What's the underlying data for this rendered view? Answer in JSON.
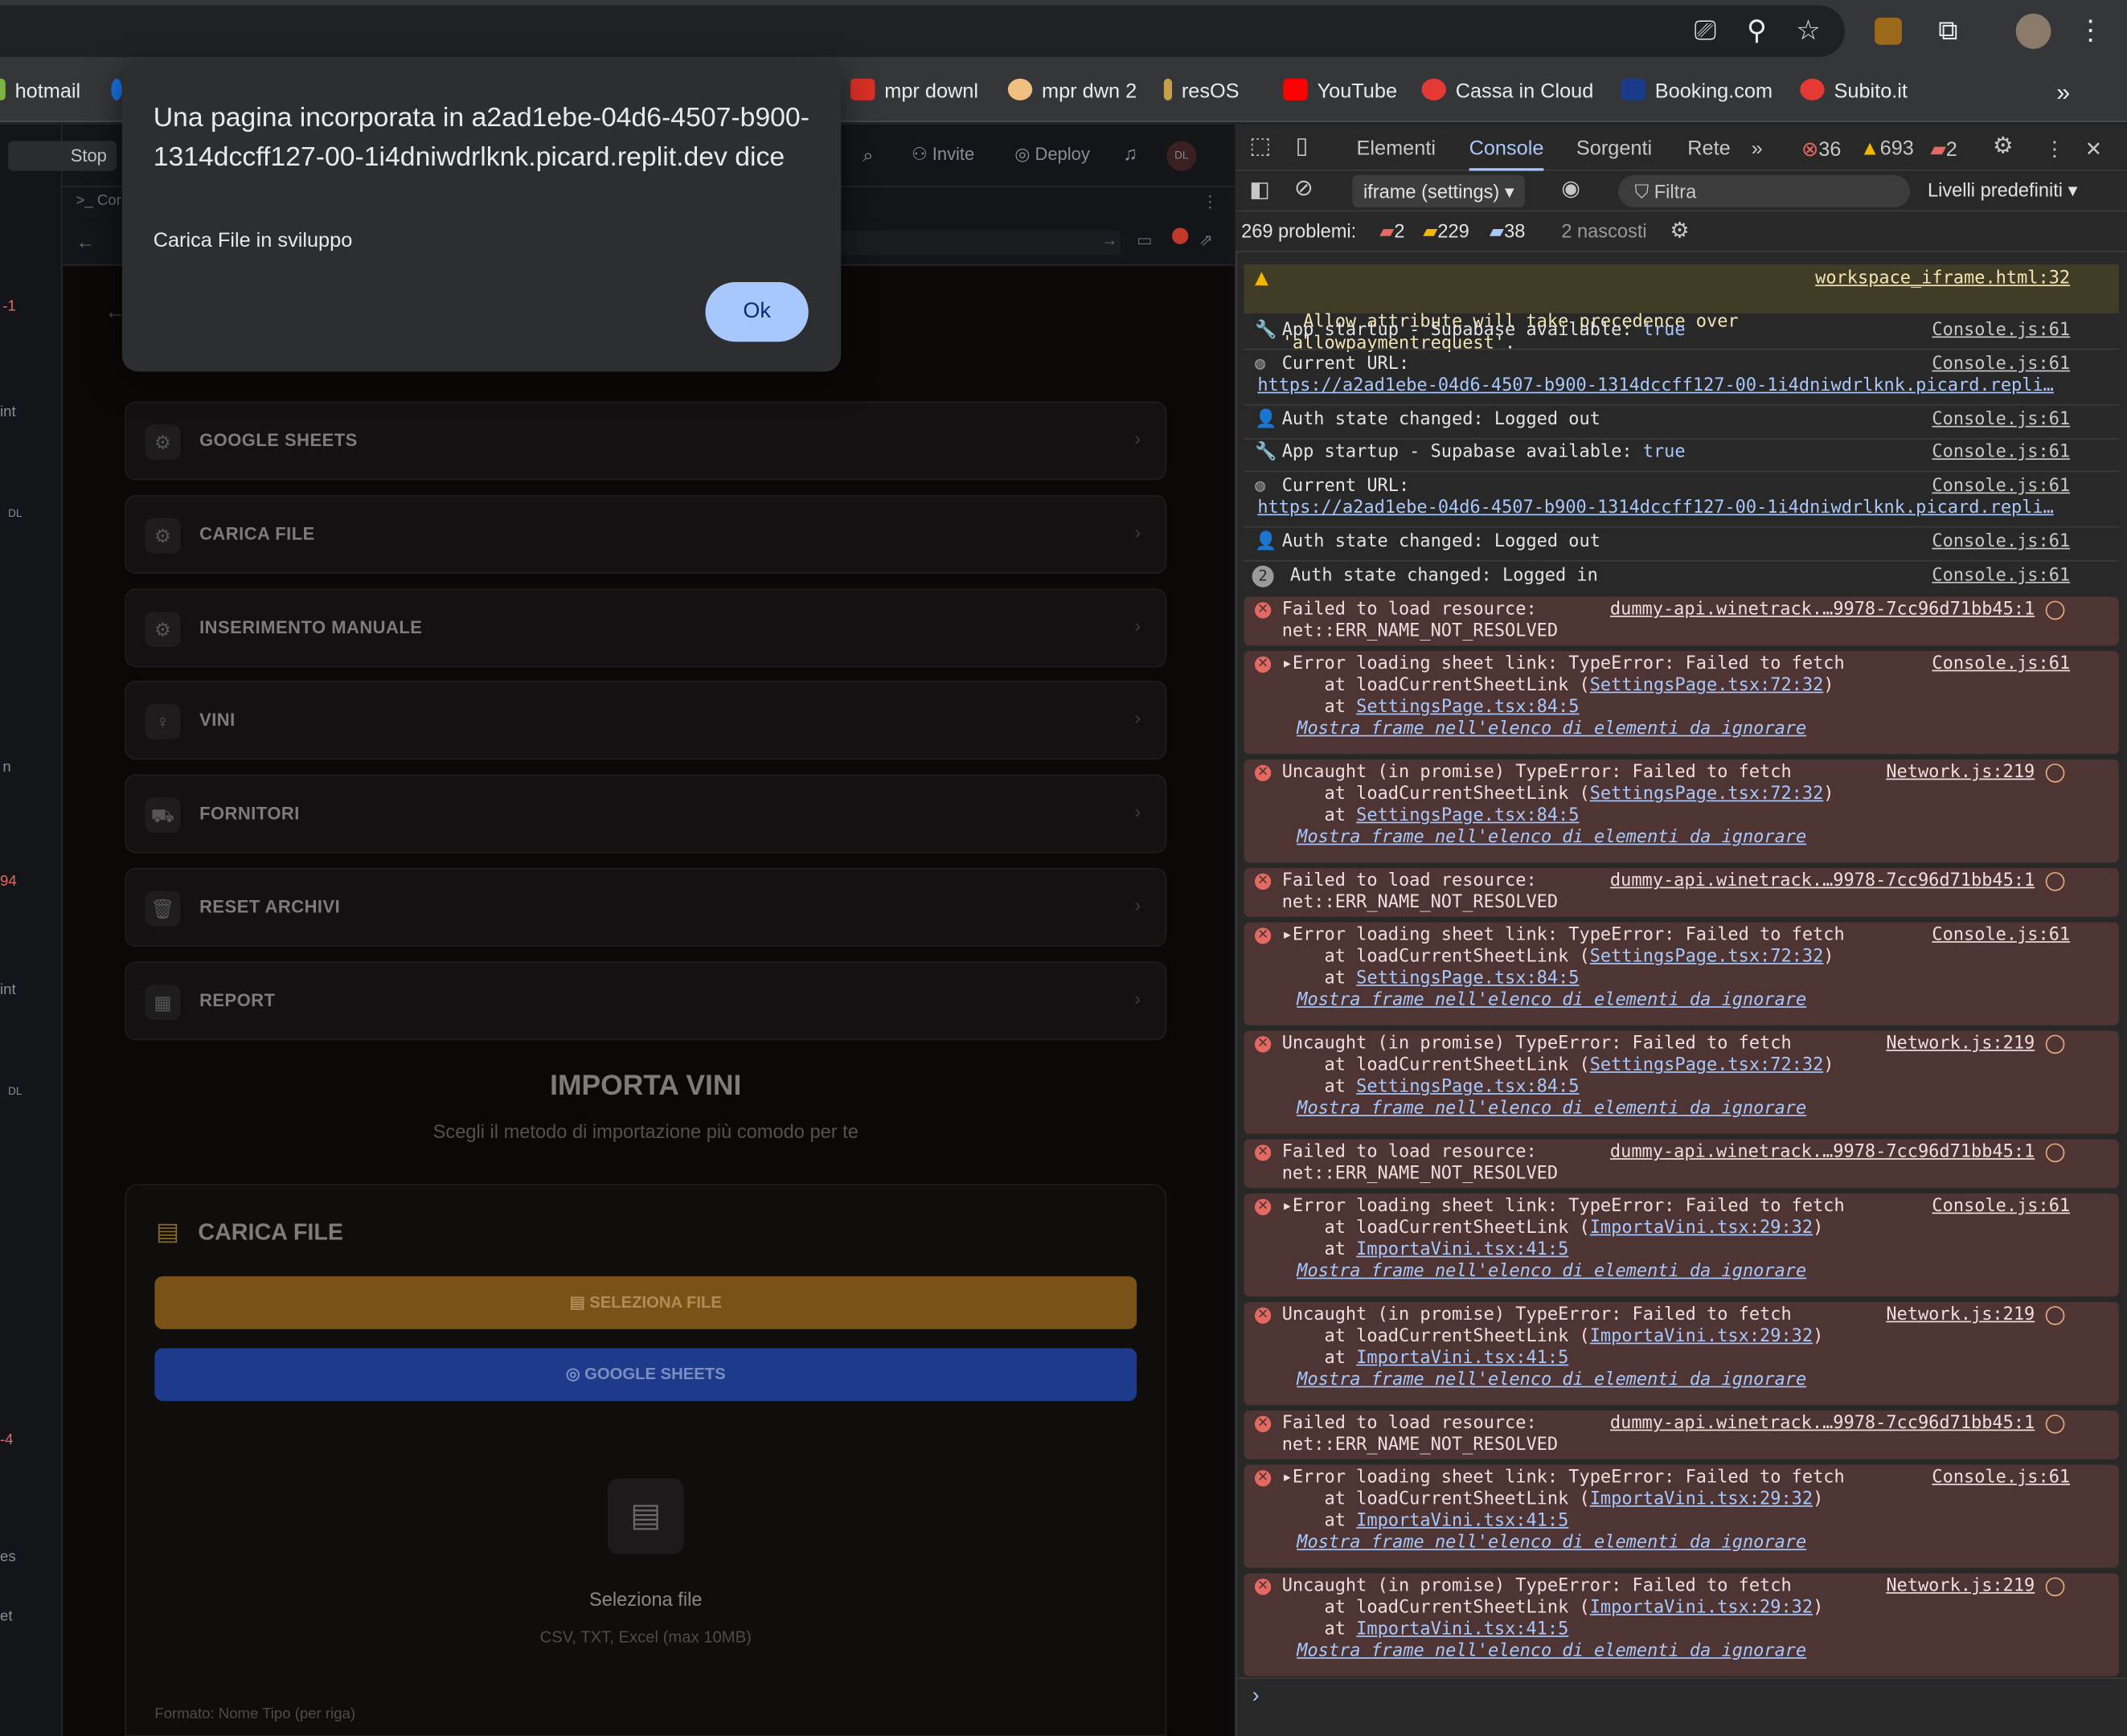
{
  "browser": {
    "bookmarks": [
      "hotmail",
      "mpr downl",
      "mpr dwn 2",
      "resOS",
      "YouTube",
      "Cassa in Cloud",
      "Booking.com",
      "Subito.it"
    ]
  },
  "replit": {
    "stop": "Stop",
    "invite": "Invite",
    "deploy": "Deploy",
    "avatar": "DL",
    "tab_partial": "Cor",
    "strip_items": [
      "-1",
      "int",
      "DL",
      "n",
      "94",
      "int",
      "DL",
      "-4",
      "es",
      "et"
    ]
  },
  "app": {
    "menu": [
      {
        "label": "GOOGLE SHEETS",
        "icon": "gear-icon"
      },
      {
        "label": "CARICA FILE",
        "icon": "gear-icon"
      },
      {
        "label": "INSERIMENTO MANUALE",
        "icon": "gear-icon"
      },
      {
        "label": "VINI",
        "icon": "wine-icon"
      },
      {
        "label": "FORNITORI",
        "icon": "truck-icon"
      },
      {
        "label": "RESET ARCHIVI",
        "icon": "trash-icon"
      },
      {
        "label": "REPORT",
        "icon": "calendar-icon"
      }
    ],
    "import_title": "IMPORTA VINI",
    "import_subtitle": "Scegli il metodo di importazione più comodo per te",
    "panel_title": "CARICA FILE",
    "select_file_button": "SELEZIONA FILE",
    "google_sheets_button": "GOOGLE SHEETS",
    "drop_title": "Seleziona file",
    "drop_hint": "CSV, TXT, Excel (max 10MB)",
    "format": "Formato: Nome Tipo (per riga)",
    "colors": {
      "select": "#8a5c1c",
      "sheets": "#1e3a8a"
    }
  },
  "dialog": {
    "title": "Una pagina incorporata in a2ad1ebe-04d6-4507-b900-1314dccff127-00-1i4dniwdrlknk.picard.replit.dev dice",
    "message": "Carica File in sviluppo",
    "ok": "Ok"
  },
  "devtools": {
    "tabs": [
      "Elementi",
      "Console",
      "Sorgenti",
      "Rete"
    ],
    "errors": "36",
    "warnings": "693",
    "issues": "2",
    "context": "iframe (settings)",
    "filter": "Filtra",
    "levels": "Livelli predefiniti",
    "problems_label": "269 problemi:",
    "p_err": "2",
    "p_warn": "229",
    "p_info": "38",
    "hidden": "2 nascosti",
    "warning_line1": "Allow attribute will take precedence over",
    "warning_line2": "'allowpaymentrequest'.",
    "warning_src": "workspace_iframe.html:32",
    "startup": "App startup - Supabase available: ",
    "startup_val": "true",
    "current_url": "Current URL:",
    "url": "https://a2ad1ebe-04d6-4507-b900-1314dccff127-00-1i4dniwdrlknk.picard.repli…",
    "logged_out": "Auth state changed: Logged out",
    "logged_in": "Auth state changed: Logged in",
    "count2": "2",
    "console_src": "Console.js:61",
    "network_src": "Network.js:219",
    "fail1": "Failed to load resource:",
    "fail2": "net::ERR_NAME_NOT_RESOLVED",
    "fail_src": "dummy-api.winetrack.…9978-7cc96d71bb45:1",
    "sheet_err": "Error loading sheet link: TypeError: Failed to fetch",
    "uncaught": "Uncaught (in promise) TypeError: Failed to fetch",
    "at_load": "    at loadCurrentSheetLink (",
    "settings_a": "SettingsPage.tsx:72:32",
    "settings_b": "SettingsPage.tsx:84:5",
    "import_a": "ImportaVini.tsx:29:32",
    "import_b": "ImportaVini.tsx:41:5",
    "at": "    at ",
    "ignore": "Mostra frame nell'elenco di elementi da ignorare"
  }
}
